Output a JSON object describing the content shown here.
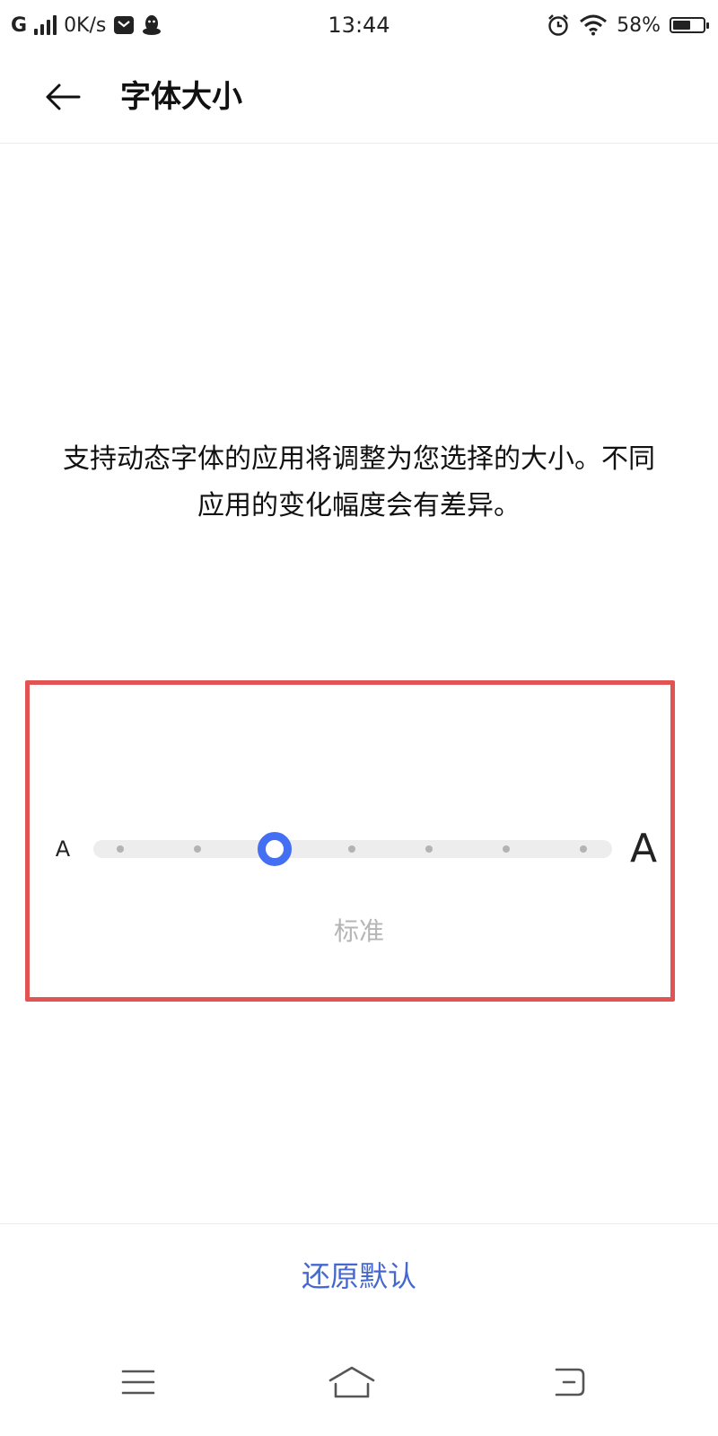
{
  "status_bar": {
    "network": "G",
    "speed": "0K/s",
    "time": "13:44",
    "battery_percent": "58%",
    "battery_level": 0.58,
    "icons": [
      "signal-icon",
      "message-icon",
      "qq-penguin-icon",
      "alarm-icon",
      "wifi-icon",
      "battery-icon"
    ]
  },
  "header": {
    "title": "字体大小",
    "back_icon": "back-arrow-icon"
  },
  "description": "支持动态字体的应用将调整为您选择的大小。不同应用的变化幅度会有差异。",
  "font_slider": {
    "small_label": "A",
    "large_label": "A",
    "steps": 7,
    "selected_index": 2,
    "selected_label": "标准",
    "accent_color": "#456ff2",
    "highlight_color": "#e25353"
  },
  "footer": {
    "restore_label": "还原默认",
    "restore_color": "#4468cf"
  },
  "navigation_bar": {
    "icons": [
      "menu-icon",
      "home-icon",
      "back-icon"
    ]
  }
}
